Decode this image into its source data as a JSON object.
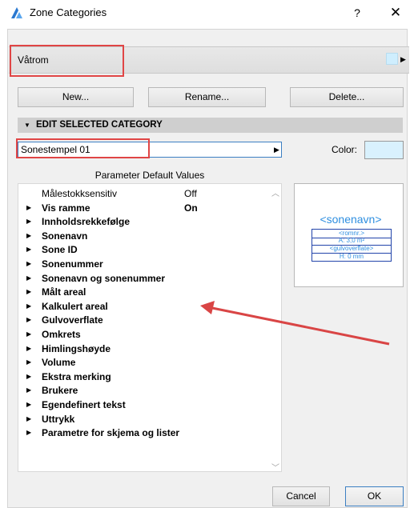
{
  "window": {
    "title": "Zone Categories",
    "help_label": "?",
    "close_label": "✕"
  },
  "category": {
    "selected": "Våtrom",
    "swatch_color": "#cfeefe"
  },
  "buttons": {
    "new": "New...",
    "rename": "Rename...",
    "delete": "Delete..."
  },
  "section": {
    "title": "EDIT SELECTED CATEGORY"
  },
  "stamp": {
    "selected": "Sonestempel 01",
    "color_label": "Color:",
    "color": "#d9f1fd"
  },
  "parameters": {
    "header": "Parameter Default Values",
    "rows": [
      {
        "label": "Målestokksensitiv",
        "value": "Off",
        "expandable": false,
        "bold": false
      },
      {
        "label": "Vis ramme",
        "value": "On",
        "expandable": true,
        "bold": true
      },
      {
        "label": "Innholdsrekkefølge",
        "value": "",
        "expandable": true,
        "bold": true
      },
      {
        "label": "Sonenavn",
        "value": "",
        "expandable": true,
        "bold": true
      },
      {
        "label": "Sone ID",
        "value": "",
        "expandable": true,
        "bold": true
      },
      {
        "label": "Sonenummer",
        "value": "",
        "expandable": true,
        "bold": true
      },
      {
        "label": "Sonenavn og sonenummer",
        "value": "",
        "expandable": true,
        "bold": true
      },
      {
        "label": "Målt areal",
        "value": "",
        "expandable": true,
        "bold": true
      },
      {
        "label": "Kalkulert areal",
        "value": "",
        "expandable": true,
        "bold": true
      },
      {
        "label": "Gulvoverflate",
        "value": "",
        "expandable": true,
        "bold": true
      },
      {
        "label": "Omkrets",
        "value": "",
        "expandable": true,
        "bold": true
      },
      {
        "label": "Himlingshøyde",
        "value": "",
        "expandable": true,
        "bold": true
      },
      {
        "label": "Volume",
        "value": "",
        "expandable": true,
        "bold": true
      },
      {
        "label": "Ekstra merking",
        "value": "",
        "expandable": true,
        "bold": true
      },
      {
        "label": "Brukere",
        "value": "",
        "expandable": true,
        "bold": true
      },
      {
        "label": "Egendefinert tekst",
        "value": "",
        "expandable": true,
        "bold": true
      },
      {
        "label": "Uttrykk",
        "value": "",
        "expandable": true,
        "bold": true
      },
      {
        "label": "Parametre for skjema og lister",
        "value": "",
        "expandable": true,
        "bold": true
      }
    ]
  },
  "preview": {
    "title": "<sonenavn>",
    "lines": [
      "<romnr.>",
      "A: 3,0 m²",
      "<gulvoverflate>",
      "H: 0 mm"
    ]
  },
  "footer": {
    "cancel": "Cancel",
    "ok": "OK"
  },
  "colors": {
    "highlight": "#e04545",
    "annotation_arrow": "#d94545",
    "preview_text": "#2f8fe0"
  },
  "icons": {
    "app": "archicad-app-icon",
    "expand": "triangle-right-icon",
    "collapse": "triangle-down-icon"
  }
}
